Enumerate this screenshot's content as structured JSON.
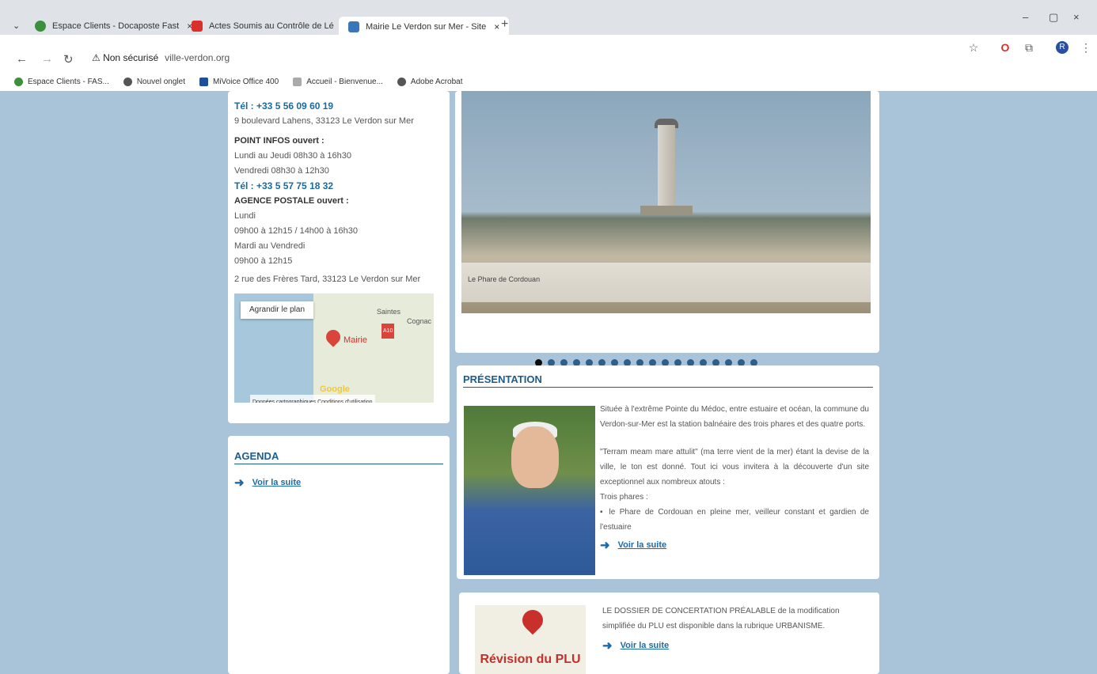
{
  "browser": {
    "tabs": [
      {
        "title": "Espace Clients - Docaposte Fast",
        "color": "#3c8f3c"
      },
      {
        "title": "Actes Soumis au Contrôle de Lé",
        "color": "#d9302c"
      },
      {
        "title": "Mairie Le Verdon sur Mer - Site",
        "color": "#3a77b8"
      }
    ],
    "new_tab": "+",
    "window_controls": [
      "–",
      "▢",
      "×"
    ],
    "security": "⚠ Non sécurisé",
    "url": "ville-verdon.org",
    "profile_initial": "R",
    "bookmarks": [
      {
        "label": "Espace Clients - FAS...",
        "color": "#3c8f3c"
      },
      {
        "label": "Nouvel onglet",
        "color": "#555555"
      },
      {
        "label": "MiVoice Office 400",
        "color": "#1d4f9a"
      },
      {
        "label": "Accueil - Bienvenue...",
        "color": "#aaaaaa"
      },
      {
        "label": "Adobe Acrobat",
        "color": "#555555"
      }
    ]
  },
  "contact": {
    "tel1": "Tél : +33 5 56 09 60 19",
    "address1": "9 boulevard Lahens, 33123 Le Verdon sur Mer",
    "point_infos_title": "POINT INFOS ouvert :",
    "point_infos_lines": [
      "Lundi au Jeudi 08h30 à 16h30",
      "Vendredi 08h30 à 12h30"
    ],
    "tel2": "Tél : +33 5 57 75 18 32",
    "agence_title": "AGENCE POSTALE ouvert :",
    "agence_lines": [
      "Lundi",
      "09h00 à 12h15 / 14h00 à 16h30",
      "Mardi au Vendredi",
      "09h00 à 12h15"
    ],
    "address2": "2 rue des Frères Tard, 33123 Le Verdon sur Mer",
    "map": {
      "button": "Agrandir le plan",
      "marker_label": "Mairie",
      "towns": [
        "Saintes",
        "Cognac",
        "A10"
      ],
      "google": "Google",
      "footer": "Données cartographiques   Conditions d'utilisation"
    }
  },
  "agenda": {
    "title": "AGENDA",
    "more": "Voir la suite"
  },
  "slider": {
    "caption": "Le Phare de Cordouan",
    "dot_count": 18,
    "active_dot": 0
  },
  "presentation": {
    "title": "PRÉSENTATION",
    "p1": "Située à l'extrême Pointe du Médoc, entre estuaire et océan, la commune du Verdon-sur-Mer est la station balnéaire des trois phares et des quatre ports.",
    "p2": "\"Terram meam mare attulit\" (ma terre vient de la mer) étant la devise de la ville, le ton est donné. Tout ici vous invitera à la découverte d'un site exceptionnel aux nombreux atouts :",
    "p3": "Trois phares :",
    "p4": "▪ le Phare de Cordouan en pleine mer, veilleur constant et gardien de l'estuaire",
    "more": "Voir la suite"
  },
  "plu": {
    "image_title": "Révision du PLU",
    "text": "LE DOSSIER DE CONCERTATION PRÉALABLE de la modification simplifiée du PLU est disponible dans la rubrique URBANISME.",
    "more": "Voir la suite"
  }
}
